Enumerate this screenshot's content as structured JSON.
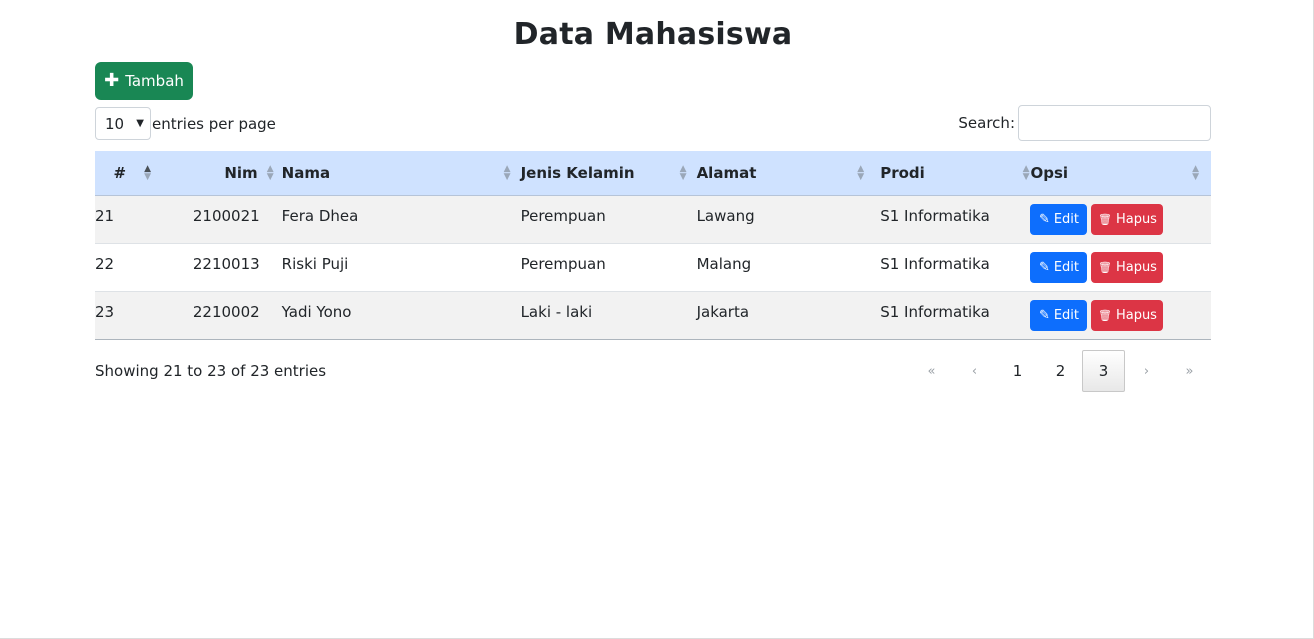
{
  "page": {
    "title": "Data Mahasiswa",
    "add_button": "Tambah"
  },
  "controls": {
    "page_length": "10",
    "length_label": "entries per page",
    "search_label": "Search:",
    "search_value": ""
  },
  "table": {
    "columns": [
      "#",
      "Nim",
      "Nama",
      "Jenis Kelamin",
      "Alamat",
      "Prodi",
      "Opsi"
    ],
    "rows": [
      {
        "no": "21",
        "nim": "2100021",
        "nama": "Fera Dhea",
        "jk": "Perempuan",
        "alamat": "Lawang",
        "prodi": "S1 Informatika"
      },
      {
        "no": "22",
        "nim": "2210013",
        "nama": "Riski Puji",
        "jk": "Perempuan",
        "alamat": "Malang",
        "prodi": "S1 Informatika"
      },
      {
        "no": "23",
        "nim": "2210002",
        "nama": "Yadi Yono",
        "jk": "Laki - laki",
        "alamat": "Jakarta",
        "prodi": "S1 Informatika"
      }
    ],
    "edit_label": "Edit",
    "delete_label": "Hapus"
  },
  "footer": {
    "info": "Showing 21 to 23 of 23 entries",
    "pagination": {
      "first": "«",
      "prev": "‹",
      "pages": [
        "1",
        "2",
        "3"
      ],
      "current": "3",
      "next": "›",
      "last": "»"
    }
  },
  "colors": {
    "add_button": "#198754",
    "header_bg": "#cfe2ff",
    "edit_button": "#0d6efd",
    "delete_button": "#dc3545"
  }
}
